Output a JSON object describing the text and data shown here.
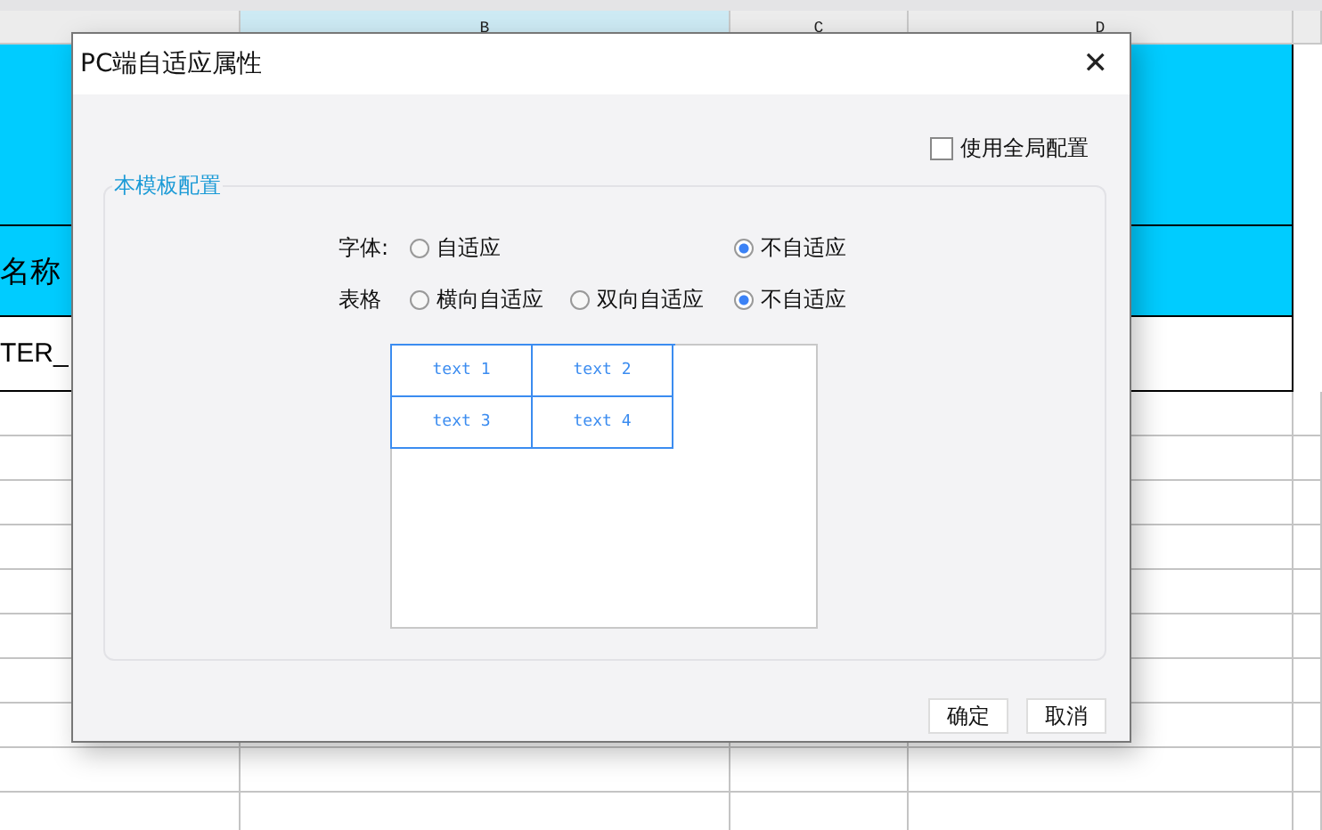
{
  "sheet": {
    "columns": [
      {
        "selected": false
      },
      {
        "label": "B",
        "selected": true
      },
      {
        "label": "C",
        "selected": false
      },
      {
        "label": "D",
        "selected": false
      },
      {
        "selected": false
      }
    ],
    "header_cell": "名称",
    "value_cell": "TER_"
  },
  "dialog": {
    "title": "PC端自适应属性",
    "close": "✕",
    "global_config": {
      "label": "使用全局配置",
      "checked": false
    },
    "group": {
      "legend": "本模板配置",
      "rows": [
        {
          "label": "字体:",
          "options": [
            {
              "label": "自适应",
              "selected": false
            },
            {
              "label": "不自适应",
              "selected": true
            }
          ]
        },
        {
          "label": "表格",
          "options": [
            {
              "label": "横向自适应",
              "selected": false
            },
            {
              "label": "双向自适应",
              "selected": false
            },
            {
              "label": "不自适应",
              "selected": true
            }
          ]
        }
      ],
      "preview_cells": [
        "text 1",
        "text 2",
        "text 3",
        "text 4"
      ]
    },
    "buttons": [
      "确定",
      "取消"
    ]
  }
}
